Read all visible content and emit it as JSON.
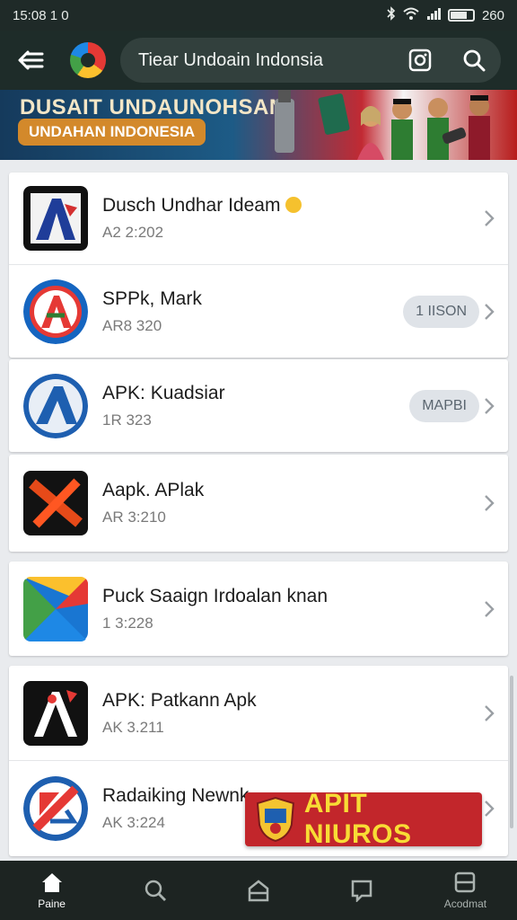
{
  "status": {
    "time": "15:08 1 0",
    "battery": "260"
  },
  "header": {
    "search_text": "Tiear Undoain Indonsia"
  },
  "banner": {
    "title": "DUSAIT UNDAUNOHSAN",
    "pill": "UNDAHAN INDONESIA"
  },
  "apps": [
    {
      "title": "Dusch Undhar Ideam",
      "sub": "A2 2:202",
      "badge": ""
    },
    {
      "title": "SPPk, Mark",
      "sub": "AR8 320",
      "badge": "1 IISON"
    },
    {
      "title": "APK: Kuadsiar",
      "sub": "1R 323",
      "badge": "MAPBI"
    },
    {
      "title": "Aapk. APlak",
      "sub": "AR 3:210",
      "badge": ""
    },
    {
      "title": "Puck Saaign Irdoalan knan",
      "sub": "1 3:228",
      "badge": ""
    },
    {
      "title": "APK: Patkann Apk",
      "sub": "AK 3.211",
      "badge": ""
    },
    {
      "title": "Radaiking Newnk",
      "sub": "AK 3:224",
      "badge": ""
    }
  ],
  "promo": {
    "label": "APIT NIUROS"
  },
  "nav": {
    "home": "Paine",
    "account": "Acodmat"
  },
  "colors": {
    "appbar": "#1e2c29",
    "promo": "#c2262b",
    "promo_text": "#f8dc35"
  }
}
